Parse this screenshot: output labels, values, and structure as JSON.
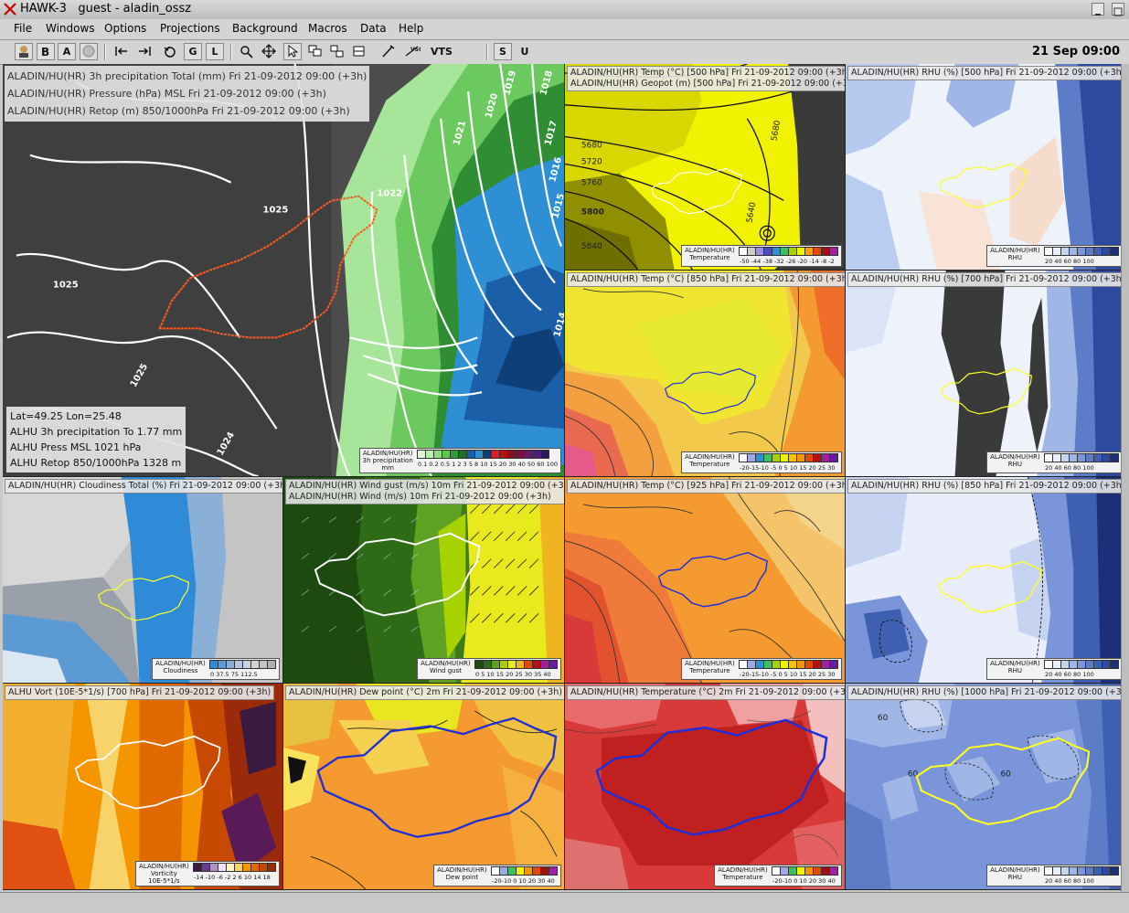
{
  "window": {
    "title": "HAWK-3   guest - aladin_ossz"
  },
  "menu": [
    "File",
    "Windows",
    "Options",
    "Projections",
    "Background",
    "Macros",
    "Data",
    "Help"
  ],
  "toolbar": {
    "a_label": "A",
    "g_label": "G",
    "l_label": "L",
    "vts_label": "VTS",
    "s_label": "S",
    "u_label": "U",
    "datetime": "21 Sep 09:00"
  },
  "main_panel": {
    "captions": [
      "ALADIN/HU(HR) 3h precipitation Total (mm) Fri 21-09-2012 09:00 (+3h)",
      "ALADIN/HU(HR) Pressure (hPa) MSL Fri 21-09-2012 09:00 (+3h)",
      "ALADIN/HU(HR) Retop (m) 850/1000hPa Fri 21-09-2012 09:00 (+3h)"
    ],
    "readout": {
      "latlon": "Lat=49.25 Lon=25.48",
      "line1": "ALHU 3h precipitation To   1.77 mm",
      "line2": "ALHU Press MSL   1021 hPa",
      "line3": "ALHU Retop 850/1000hPa    1328 m"
    },
    "contour_labels": [
      "1025",
      "1025",
      "1025",
      "1024",
      "1022",
      "1021",
      "1020",
      "1019",
      "1018",
      "1017",
      "1016",
      "1015",
      "1014"
    ],
    "legend": {
      "model": "ALADIN/HU(HR)",
      "name": "3h precipitation",
      "unit": "mm",
      "ticks": "0.1 0.2 0.5  1   2   3   5   8  10  15  20  30  40  50  60  100"
    }
  },
  "panels": [
    {
      "caption": "ALADIN/HU(HR) Temp (°C) [500 hPa] Fri 21-09-2012 09:00 (+3h)",
      "caption2": "ALADIN/HU(HR) Geopot (m) [500 hPa] Fri 21-09-2012 09:00 (+3h)",
      "legend_name": "Temperature",
      "legend_ticks": "-50 -44 -38 -32 -26 -20 -14 -8 -2",
      "contour_labels": [
        "5680",
        "5720",
        "5760",
        "5800",
        "5840",
        "5640",
        "5680"
      ]
    },
    {
      "caption": "ALADIN/HU(HR) RHU (%) [500 hPa] Fri 21-09-2012 09:00 (+3h)",
      "legend_name": "RHU",
      "legend_ticks": "20 40 60 80 100"
    },
    {
      "caption": "ALADIN/HU(HR) Temp (°C) [850 hPa] Fri 21-09-2012 09:00 (+3h)",
      "legend_name": "Temperature",
      "legend_ticks": "-20-15-10 -5 0 5 10 15 20 25 30"
    },
    {
      "caption": "ALADIN/HU(HR) RHU (%) [700 hPa] Fri 21-09-2012 09:00 (+3h)",
      "legend_name": "RHU",
      "legend_ticks": "20 40 60 80 100"
    },
    {
      "caption": "ALADIN/HU(HR) Cloudiness Total (%) Fri 21-09-2012 09:00 (+3h)",
      "legend_name": "Cloudiness",
      "legend_ticks": "0  37.5  75  112.5"
    },
    {
      "caption": "ALADIN/HU(HR) Wind gust (m/s) 10m Fri 21-09-2012 09:00 (+3h)",
      "caption2": "ALADIN/HU(HR) Wind (m/s) 10m Fri 21-09-2012 09:00 (+3h)",
      "legend_name": "Wind gust",
      "legend_ticks": "0 5 10 15 20 25 30 35 40"
    },
    {
      "caption": "ALADIN/HU(HR) Temp (°C) [925 hPa] Fri 21-09-2012 09:00 (+3h)",
      "legend_name": "Temperature",
      "legend_ticks": "-20-15-10 -5 0 5 10 15 20 25 30"
    },
    {
      "caption": "ALADIN/HU(HR) RHU (%) [850 hPa] Fri 21-09-2012 09:00 (+3h)",
      "legend_name": "RHU",
      "legend_ticks": "20 40 60 80 100"
    },
    {
      "caption": "ALHU Vort (10E-5*1/s) [700 hPa] Fri 21-09-2012 09:00 (+3h)",
      "legend_name": "Vorticity",
      "legend_unit": "10E-5*1/s",
      "legend_ticks": "-14 -10 -6 -2 2 6 10 14 18"
    },
    {
      "caption": "ALADIN/HU(HR) Dew point (°C) 2m Fri 21-09-2012 09:00 (+3h)",
      "legend_name": "Dew point",
      "legend_ticks": "-20-10 0 10 20 30 40"
    },
    {
      "caption": "ALADIN/HU(HR) Temperature (°C) 2m Fri 21-09-2012 09:00 (+3h)",
      "legend_name": "Temperature",
      "legend_ticks": "-20-10 0 10 20 30 40"
    },
    {
      "caption": "ALADIN/HU(HR) RHU (%) [1000 hPa] Fri 21-09-2012 09:00 (+3h)",
      "legend_name": "RHU",
      "legend_ticks": "20 40 60 80 100",
      "contour_labels": [
        "60",
        "60",
        "60"
      ]
    }
  ],
  "legend_model": "ALADIN/HU(HR)"
}
